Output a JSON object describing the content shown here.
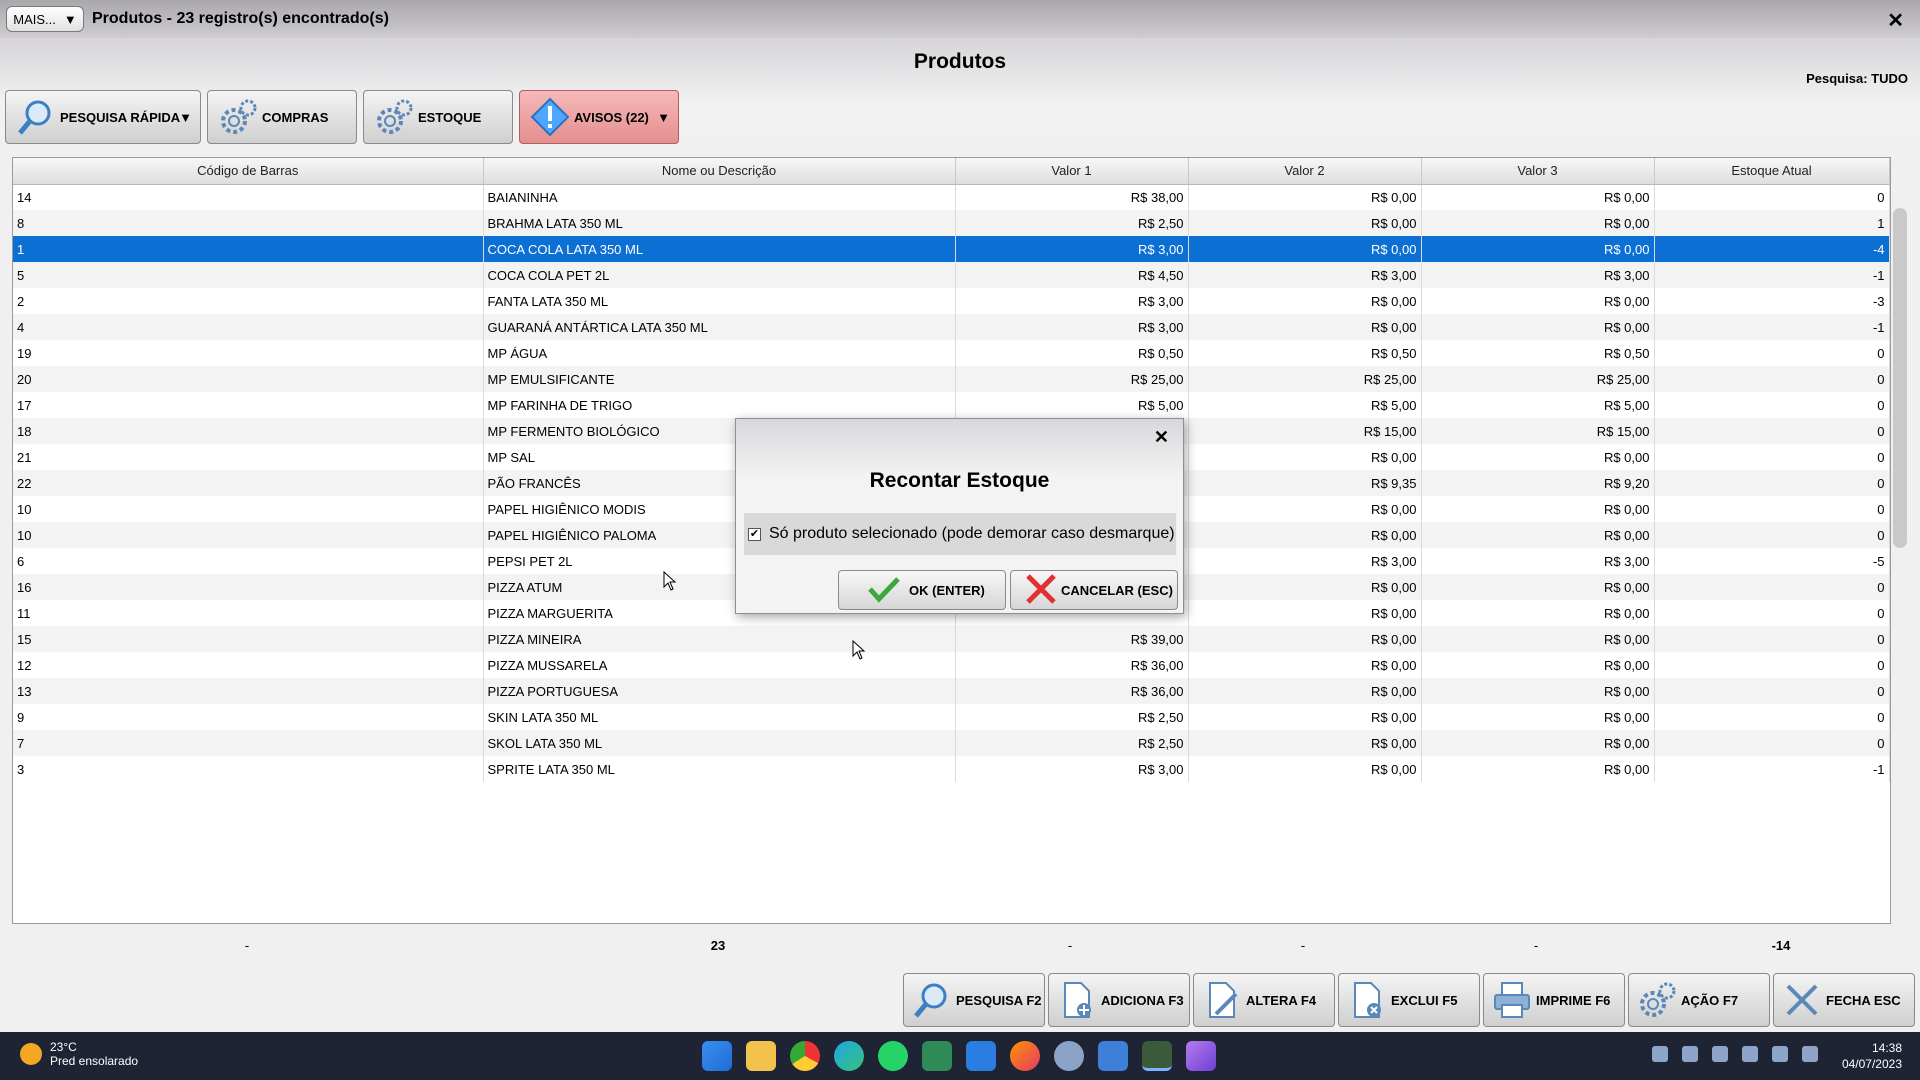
{
  "window": {
    "mais_label": "MAIS...",
    "title": "Produtos - 23 registro(s) encontrado(s)",
    "close_glyph": "✕"
  },
  "header": {
    "page_title": "Produtos",
    "search_label": "Pesquisa:",
    "search_value": "TUDO"
  },
  "toolbar": {
    "quick_search": "PESQUISA RÁPIDA",
    "purchases": "COMPRAS",
    "stock": "ESTOQUE",
    "warnings": "AVISOS (22)"
  },
  "table": {
    "columns": [
      "Código de Barras",
      "Nome ou Descrição",
      "Valor 1",
      "Valor 2",
      "Valor 3",
      "Estoque Atual"
    ],
    "rows": [
      [
        "14",
        "BAIANINHA",
        "R$ 38,00",
        "R$ 0,00",
        "R$ 0,00",
        "0"
      ],
      [
        "8",
        "BRAHMA LATA 350 ML",
        "R$ 2,50",
        "R$ 0,00",
        "R$ 0,00",
        "1"
      ],
      [
        "1",
        "COCA COLA LATA 350 ML",
        "R$ 3,00",
        "R$ 0,00",
        "R$ 0,00",
        "-4"
      ],
      [
        "5",
        "COCA COLA PET 2L",
        "R$ 4,50",
        "R$ 3,00",
        "R$ 3,00",
        "-1"
      ],
      [
        "2",
        "FANTA LATA 350 ML",
        "R$ 3,00",
        "R$ 0,00",
        "R$ 0,00",
        "-3"
      ],
      [
        "4",
        "GUARANÁ ANTÁRTICA LATA 350 ML",
        "R$ 3,00",
        "R$ 0,00",
        "R$ 0,00",
        "-1"
      ],
      [
        "19",
        "MP ÁGUA",
        "R$ 0,50",
        "R$ 0,50",
        "R$ 0,50",
        "0"
      ],
      [
        "20",
        "MP EMULSIFICANTE",
        "R$ 25,00",
        "R$ 25,00",
        "R$ 25,00",
        "0"
      ],
      [
        "17",
        "MP FARINHA DE TRIGO",
        "R$ 5,00",
        "R$ 5,00",
        "R$ 5,00",
        "0"
      ],
      [
        "18",
        "MP FERMENTO BIOLÓGICO",
        "",
        "R$ 15,00",
        "R$ 15,00",
        "0"
      ],
      [
        "21",
        "MP SAL",
        "",
        "R$ 0,00",
        "R$ 0,00",
        "0"
      ],
      [
        "22",
        "PÃO FRANCÊS",
        "",
        "R$ 9,35",
        "R$ 9,20",
        "0"
      ],
      [
        "10",
        "PAPEL HIGIÊNICO MODIS",
        "",
        "R$ 0,00",
        "R$ 0,00",
        "0"
      ],
      [
        "10",
        "PAPEL HIGIÊNICO PALOMA",
        "",
        "R$ 0,00",
        "R$ 0,00",
        "0"
      ],
      [
        "6",
        "PEPSI PET 2L",
        "",
        "R$ 3,00",
        "R$ 3,00",
        "-5"
      ],
      [
        "16",
        "PIZZA ATUM",
        "",
        "R$ 0,00",
        "R$ 0,00",
        "0"
      ],
      [
        "11",
        "PIZZA MARGUERITA",
        "",
        "R$ 0,00",
        "R$ 0,00",
        "0"
      ],
      [
        "15",
        "PIZZA MINEIRA",
        "R$ 39,00",
        "R$ 0,00",
        "R$ 0,00",
        "0"
      ],
      [
        "12",
        "PIZZA MUSSARELA",
        "R$ 36,00",
        "R$ 0,00",
        "R$ 0,00",
        "0"
      ],
      [
        "13",
        "PIZZA PORTUGUESA",
        "R$ 36,00",
        "R$ 0,00",
        "R$ 0,00",
        "0"
      ],
      [
        "9",
        "SKIN LATA 350 ML",
        "R$ 2,50",
        "R$ 0,00",
        "R$ 0,00",
        "0"
      ],
      [
        "7",
        "SKOL LATA 350 ML",
        "R$ 2,50",
        "R$ 0,00",
        "R$ 0,00",
        "0"
      ],
      [
        "3",
        "SPRITE LATA 350 ML",
        "R$ 3,00",
        "R$ 0,00",
        "R$ 0,00",
        "-1"
      ]
    ],
    "selected_index": 2,
    "totals": [
      "-",
      "23",
      "-",
      "-",
      "-",
      "-14"
    ]
  },
  "footer": {
    "search": "PESQUISA F2",
    "add": "ADICIONA F3",
    "edit": "ALTERA F4",
    "delete": "EXCLUI F5",
    "print": "IMPRIME F6",
    "action": "AÇÃO F7",
    "close": "FECHA ESC"
  },
  "dialog": {
    "title": "Recontar Estoque",
    "close_glyph": "✕",
    "checkbox_label": "Só produto selecionado (pode demorar caso desmarque)",
    "checkbox_checked": true,
    "ok_label": "OK (ENTER)",
    "cancel_label": "CANCELAR (ESC)"
  },
  "taskbar": {
    "temperature": "23°C",
    "weather": "Pred ensolarado",
    "time": "14:38",
    "date": "04/07/2023"
  },
  "colors": {
    "selection": "#0c6fd4",
    "warning_button": "#e48f8f",
    "ok_check": "#3aa83a",
    "cancel_x": "#e03030"
  }
}
